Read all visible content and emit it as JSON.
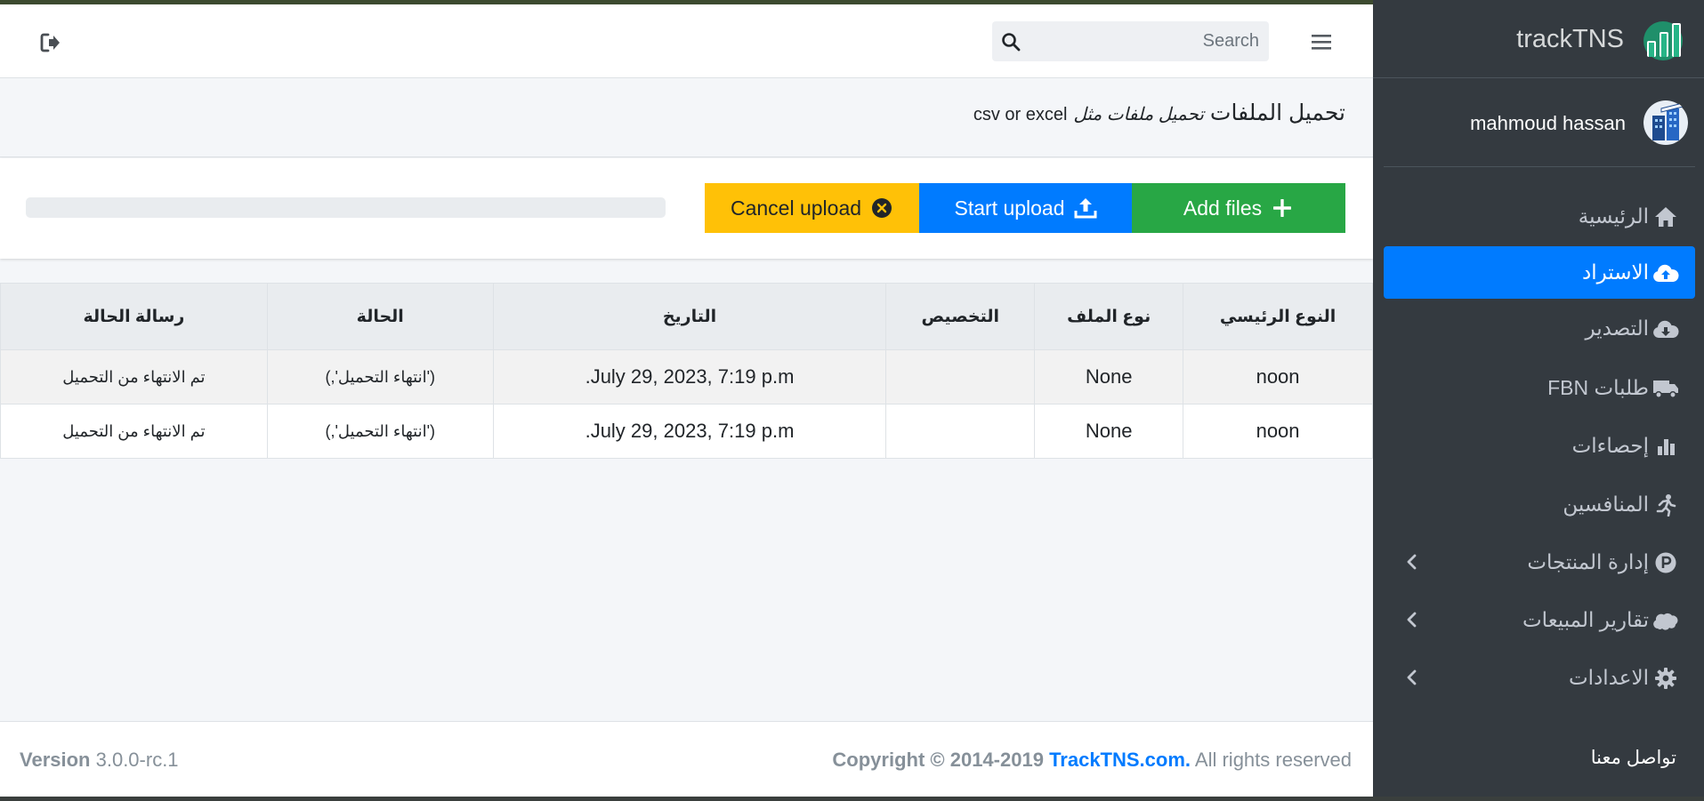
{
  "navbar": {
    "search_placeholder": "Search"
  },
  "header": {
    "title": "تحميل الملفات",
    "subtitle": "تحميل ملفات مثل",
    "subtitle_suffix": "csv or excel"
  },
  "upload": {
    "cancel_label": "Cancel upload",
    "start_label": "Start upload",
    "add_label": "Add files",
    "progress_percent": 0
  },
  "table": {
    "headers": [
      "النوع الرئيسي",
      "نوع الملف",
      "التخصيص",
      "التاريخ",
      "الحالة",
      "رسالة الحالة"
    ],
    "rows": [
      [
        "noon",
        "None",
        "",
        "July 29, 2023, 7:19 p.m.",
        "('انتهاء التحميل',)",
        "تم الانتهاء من التحميل"
      ],
      [
        "noon",
        "None",
        "",
        "July 29, 2023, 7:19 p.m.",
        "('انتهاء التحميل',)",
        "تم الانتهاء من التحميل"
      ]
    ]
  },
  "footer": {
    "version_label": "Version",
    "version_value": "3.0.0-rc.1",
    "copyright_prefix": "Copyright © 2014-2019",
    "copyright_link": "TrackTNS.com.",
    "copyright_suffix": "All rights reserved"
  },
  "sidebar": {
    "brand": "trackTNS",
    "user_name": "mahmoud hassan",
    "items": [
      {
        "label": "الرئيسية",
        "icon": "home-icon"
      },
      {
        "label": "الاستراد",
        "icon": "cloud-upload-icon"
      },
      {
        "label": "التصدير",
        "icon": "cloud-download-icon"
      },
      {
        "label": "طلبات FBN",
        "icon": "truck-icon"
      },
      {
        "label": "إحصاءات",
        "icon": "bar-chart-icon"
      },
      {
        "label": "المنافسين",
        "icon": "running-icon"
      },
      {
        "label": "إدارة المنتجات",
        "icon": "parking-icon"
      },
      {
        "label": "تقارير المبيعات",
        "icon": "salesforce-icon"
      },
      {
        "label": "الاعدادات",
        "icon": "gear-icon"
      }
    ],
    "contact": "تواصل معنا"
  },
  "colors": {
    "primary": "#007bff",
    "warning": "#ffc107",
    "success": "#28a745",
    "sidebar_bg": "#343a40",
    "brand_green": "#20a77a"
  }
}
